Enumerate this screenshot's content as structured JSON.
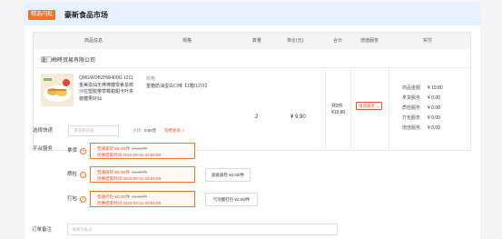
{
  "store": {
    "badge": "精选闪批",
    "title": "豪新食品市场"
  },
  "table": {
    "headers": [
      "商品信息",
      "规格",
      "数量",
      "单价(元)",
      "合计",
      "增值服务",
      "实付"
    ],
    "seller": "厦门梅咚贸易有限公司",
    "item": {
      "image_icon": "food-product-thumbnail",
      "name": "QMGWOBZHW400G 12口金美滋仙无棒棒糖零食总统沙拉塑胶带草莓甜甜卡叶夹装糖果好仙",
      "spec_label": "规格",
      "spec_value": "金箱奶油蛋白口味【1箱/12只】",
      "quantity": "2",
      "unit_price": "¥ 9.90",
      "total_count": "共2件",
      "total_amount": "¥19.80",
      "service_button": "增值服务",
      "summary": [
        {
          "key": "商品金额",
          "value": "¥ 19.80"
        },
        {
          "key": "拿货服务",
          "value": "¥ 0.00"
        },
        {
          "key": "质检服务",
          "value": "¥ 0.00"
        },
        {
          "key": "打包服务",
          "value": "¥ 0.00"
        },
        {
          "key": "增值服务",
          "value": "¥ 0.00"
        }
      ]
    }
  },
  "shipping": {
    "label": "选择快递",
    "placeholder": "请选择快递",
    "subtotal_label": "小计:",
    "subtotal_value": "0.00元",
    "link": "资费查询 >"
  },
  "platform": {
    "label": "平台服务",
    "services": [
      {
        "name": "拿货",
        "selected_line1": "普通拿货 ¥0.00/件",
        "selected_old": "¥1.00/件",
        "selected_line2": "优惠结束时间 2022-08-31 23:55:59",
        "extra": ""
      },
      {
        "name": "质检",
        "selected_line1": "普通质检 ¥0.00/件",
        "selected_old": "¥1.00/件",
        "selected_line2": "优惠结束时间 2022-08-31 23:55:59",
        "extra": "高级质检 ¥2.00/件"
      },
      {
        "name": "打包",
        "selected_line1": "普通打包 ¥0.00/件",
        "selected_old": "¥1.00/件",
        "selected_line2": "优惠结束时间 2022-08-31 23:55:59",
        "extra": "气泡膜打包 ¥2.00/件"
      }
    ]
  },
  "note": {
    "label": "订单备注",
    "placeholder": "请填写备注"
  },
  "colors": {
    "accent": "#e8542e",
    "header_bg": "#e7f0fd",
    "badge": "#f0742c"
  }
}
